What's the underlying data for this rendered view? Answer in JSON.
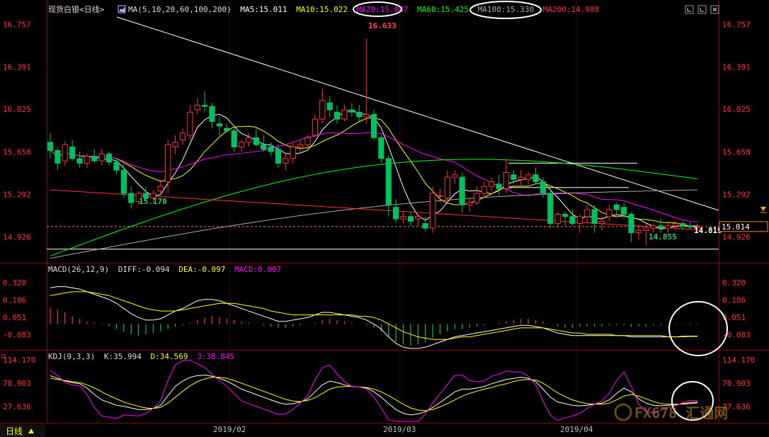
{
  "window": {
    "instrument": "现货白银<日线>",
    "period_button": "日线"
  },
  "colors": {
    "bg": "#000000",
    "up": "#ff3333",
    "down": "#00c060",
    "axis_label": "#ff3333",
    "ma5": "#ffffff",
    "ma10": "#ffff00",
    "ma20": "#ff00ff",
    "ma60": "#00ff00",
    "ma100": "#aaaaaa",
    "ma200": "#ff3333",
    "diff": "#ffffff",
    "dea": "#ffff00",
    "j_line": "#ff00ff",
    "trendline": "#ffffff"
  },
  "icons": [
    "toggle-panel-icon",
    "image-icon",
    "page-icon",
    "close-icon",
    "down-arrow-icon"
  ],
  "main_panel": {
    "header": {
      "ma_group": "MA(5,10,20,60,100,200)",
      "ma5": "MA5:15.011",
      "ma10": "MA10:15.022",
      "ma20": "MA20:15.087",
      "ma60": "MA60:15.425",
      "ma100": "MA100:15.330",
      "ma200": "MA200:14.988"
    },
    "y_ticks": [
      "16.757",
      "16.391",
      "16.025",
      "15.658",
      "15.292",
      "14.926"
    ],
    "annotations": {
      "high_label": "16.633",
      "low_label_left": "15.170",
      "low_label_right": "14.855",
      "support_label": "14.819",
      "current_price": "15.014"
    }
  },
  "macd_panel": {
    "header": {
      "name": "MACD(26,12,9)",
      "diff": "DIFF:-0.094",
      "dea": "DEA:-0.097",
      "macd": "MACD:0.007"
    },
    "y_ticks": [
      "0.320",
      "0.186",
      "0.051",
      "-0.083"
    ]
  },
  "kdj_panel": {
    "header": {
      "name": "KDJ(9,3,3)",
      "k": "K:35.994",
      "d": "D:34.569",
      "j": "J:38.845"
    },
    "y_ticks": [
      "114.170",
      "70.903",
      "27.636"
    ]
  },
  "x_axis": {
    "labels": [
      "2019/02",
      "2019/03",
      "2019/04"
    ]
  },
  "watermark": {
    "text": "FX678 汇通网"
  },
  "chart_data": {
    "type": "candlestick",
    "main": {
      "ylim": [
        14.72,
        16.82
      ],
      "candles": [
        [
          15.74,
          15.82,
          15.6,
          15.67
        ],
        [
          15.67,
          15.7,
          15.5,
          15.56
        ],
        [
          15.58,
          15.75,
          15.54,
          15.72
        ],
        [
          15.7,
          15.76,
          15.58,
          15.6
        ],
        [
          15.6,
          15.66,
          15.52,
          15.56
        ],
        [
          15.56,
          15.64,
          15.52,
          15.62
        ],
        [
          15.62,
          15.68,
          15.56,
          15.58
        ],
        [
          15.58,
          15.68,
          15.54,
          15.64
        ],
        [
          15.64,
          15.66,
          15.54,
          15.57
        ],
        [
          15.57,
          15.6,
          15.46,
          15.5
        ],
        [
          15.5,
          15.55,
          15.26,
          15.3
        ],
        [
          15.3,
          15.36,
          15.17,
          15.22
        ],
        [
          15.23,
          15.32,
          15.2,
          15.3
        ],
        [
          15.3,
          15.36,
          15.24,
          15.26
        ],
        [
          15.26,
          15.33,
          15.22,
          15.3
        ],
        [
          15.32,
          15.42,
          15.28,
          15.36
        ],
        [
          15.4,
          15.76,
          15.3,
          15.72
        ],
        [
          15.7,
          15.8,
          15.64,
          15.74
        ],
        [
          15.76,
          15.86,
          15.72,
          15.82
        ],
        [
          15.8,
          16.06,
          15.76,
          16.0
        ],
        [
          16.02,
          16.12,
          15.98,
          16.06
        ],
        [
          16.06,
          16.18,
          16.0,
          16.05
        ],
        [
          16.05,
          16.08,
          15.86,
          15.92
        ],
        [
          15.9,
          15.96,
          15.8,
          15.88
        ],
        [
          15.86,
          15.9,
          15.82,
          15.84
        ],
        [
          15.84,
          15.88,
          15.66,
          15.7
        ],
        [
          15.7,
          15.76,
          15.66,
          15.74
        ],
        [
          15.74,
          15.82,
          15.7,
          15.78
        ],
        [
          15.78,
          15.86,
          15.7,
          15.72
        ],
        [
          15.72,
          15.8,
          15.66,
          15.68
        ],
        [
          15.7,
          15.74,
          15.62,
          15.66
        ],
        [
          15.68,
          15.72,
          15.52,
          15.56
        ],
        [
          15.56,
          15.64,
          15.5,
          15.6
        ],
        [
          15.6,
          15.74,
          15.56,
          15.7
        ],
        [
          15.7,
          15.76,
          15.66,
          15.72
        ],
        [
          15.72,
          15.8,
          15.7,
          15.78
        ],
        [
          15.8,
          15.98,
          15.78,
          15.94
        ],
        [
          15.94,
          16.2,
          15.9,
          16.1
        ],
        [
          16.08,
          16.14,
          15.96,
          16.02
        ],
        [
          16.0,
          16.06,
          15.9,
          15.94
        ],
        [
          15.94,
          16.06,
          15.92,
          16.02
        ],
        [
          16.02,
          16.08,
          15.96,
          16.0
        ],
        [
          16.0,
          16.06,
          15.92,
          15.96
        ],
        [
          15.96,
          16.633,
          15.9,
          15.98
        ],
        [
          15.98,
          16.02,
          15.76,
          15.78
        ],
        [
          15.78,
          15.8,
          15.56,
          15.6
        ],
        [
          15.6,
          15.63,
          15.1,
          15.2
        ],
        [
          15.18,
          15.25,
          15.05,
          15.08
        ],
        [
          15.08,
          15.14,
          15.04,
          15.1
        ],
        [
          15.1,
          15.14,
          15.02,
          15.06
        ],
        [
          15.08,
          15.12,
          15.02,
          15.1
        ],
        [
          15.04,
          15.1,
          14.97,
          15.0
        ],
        [
          15.0,
          15.36,
          14.96,
          15.3
        ],
        [
          15.28,
          15.34,
          15.22,
          15.28
        ],
        [
          15.26,
          15.5,
          15.22,
          15.44
        ],
        [
          15.44,
          15.5,
          15.38,
          15.46
        ],
        [
          15.44,
          15.48,
          15.14,
          15.2
        ],
        [
          15.2,
          15.26,
          15.14,
          15.22
        ],
        [
          15.22,
          15.36,
          15.2,
          15.3
        ],
        [
          15.3,
          15.4,
          15.26,
          15.36
        ],
        [
          15.36,
          15.44,
          15.32,
          15.4
        ],
        [
          15.38,
          15.46,
          15.28,
          15.34
        ],
        [
          15.34,
          15.6,
          15.3,
          15.48
        ],
        [
          15.46,
          15.5,
          15.38,
          15.42
        ],
        [
          15.42,
          15.5,
          15.36,
          15.44
        ],
        [
          15.42,
          15.48,
          15.38,
          15.46
        ],
        [
          15.46,
          15.52,
          15.38,
          15.4
        ],
        [
          15.4,
          15.44,
          15.26,
          15.3
        ],
        [
          15.3,
          15.34,
          15.0,
          15.04
        ],
        [
          15.04,
          15.14,
          15.0,
          15.12
        ],
        [
          15.12,
          15.14,
          15.02,
          15.1
        ],
        [
          15.1,
          15.16,
          15.02,
          15.04
        ],
        [
          15.04,
          15.12,
          14.96,
          15.1
        ],
        [
          15.1,
          15.2,
          15.04,
          15.16
        ],
        [
          15.16,
          15.2,
          14.96,
          15.04
        ],
        [
          15.04,
          15.1,
          14.98,
          15.06
        ],
        [
          15.1,
          15.2,
          15.06,
          15.16
        ],
        [
          15.2,
          15.22,
          15.12,
          15.16
        ],
        [
          15.18,
          15.22,
          15.08,
          15.12
        ],
        [
          15.12,
          15.14,
          14.88,
          14.96
        ],
        [
          14.96,
          15.02,
          14.9,
          14.98
        ],
        [
          14.98,
          15.04,
          14.855,
          15.0
        ],
        [
          15.0,
          15.04,
          14.96,
          15.02
        ],
        [
          15.02,
          15.08,
          14.96,
          15.0
        ],
        [
          15.0,
          15.06,
          14.96,
          15.02
        ],
        [
          15.02,
          15.06,
          14.98,
          15.04
        ],
        [
          15.04,
          15.06,
          14.98,
          15.02
        ],
        [
          15.02,
          15.05,
          14.99,
          15.01
        ],
        [
          15.01,
          15.04,
          14.98,
          15.014
        ]
      ],
      "levels": {
        "support": 14.819,
        "last": 15.014
      }
    },
    "macd": {
      "ylim": [
        -0.19,
        0.37
      ],
      "histogram": [
        0.13,
        0.11,
        0.09,
        0.06,
        0.04,
        0.02,
        0.01,
        -0.005,
        -0.02,
        -0.04,
        -0.06,
        -0.08,
        -0.09,
        -0.08,
        -0.07,
        -0.06,
        -0.04,
        -0.02,
        -0.01,
        0.01,
        0.03,
        0.05,
        0.06,
        0.05,
        0.04,
        0.03,
        0.02,
        0.01,
        0.0,
        -0.01,
        -0.02,
        -0.03,
        -0.03,
        -0.02,
        -0.01,
        0.0,
        0.01,
        0.03,
        0.04,
        0.03,
        0.02,
        0.01,
        0.0,
        -0.01,
        -0.03,
        -0.06,
        -0.1,
        -0.14,
        -0.16,
        -0.17,
        -0.16,
        -0.14,
        -0.11,
        -0.08,
        -0.06,
        -0.04,
        -0.04,
        -0.03,
        -0.02,
        -0.01,
        0.0,
        0.01,
        0.02,
        0.03,
        0.04,
        0.04,
        0.03,
        0.02,
        0.0,
        -0.02,
        -0.03,
        -0.03,
        -0.02,
        -0.02,
        -0.02,
        -0.02,
        -0.01,
        -0.01,
        -0.01,
        -0.02,
        -0.02,
        -0.02,
        -0.01,
        -0.01,
        0.0,
        0.005,
        0.005,
        0.007,
        0.007
      ],
      "diff": [
        0.28,
        0.29,
        0.29,
        0.28,
        0.27,
        0.25,
        0.23,
        0.21,
        0.19,
        0.16,
        0.12,
        0.08,
        0.05,
        0.03,
        0.03,
        0.04,
        0.07,
        0.1,
        0.12,
        0.15,
        0.18,
        0.19,
        0.19,
        0.18,
        0.16,
        0.14,
        0.12,
        0.1,
        0.08,
        0.06,
        0.04,
        0.02,
        0.02,
        0.03,
        0.04,
        0.05,
        0.07,
        0.09,
        0.09,
        0.08,
        0.07,
        0.06,
        0.05,
        0.03,
        0.0,
        -0.04,
        -0.1,
        -0.15,
        -0.18,
        -0.19,
        -0.19,
        -0.18,
        -0.16,
        -0.14,
        -0.12,
        -0.1,
        -0.09,
        -0.08,
        -0.07,
        -0.06,
        -0.05,
        -0.04,
        -0.03,
        -0.02,
        -0.01,
        -0.01,
        -0.02,
        -0.03,
        -0.05,
        -0.07,
        -0.08,
        -0.09,
        -0.09,
        -0.09,
        -0.09,
        -0.09,
        -0.09,
        -0.09,
        -0.09,
        -0.1,
        -0.1,
        -0.1,
        -0.1,
        -0.1,
        -0.1,
        -0.1,
        -0.095,
        -0.094,
        -0.094
      ],
      "dea": [
        0.22,
        0.23,
        0.24,
        0.25,
        0.25,
        0.25,
        0.24,
        0.23,
        0.22,
        0.2,
        0.18,
        0.16,
        0.14,
        0.12,
        0.11,
        0.1,
        0.1,
        0.1,
        0.11,
        0.12,
        0.13,
        0.14,
        0.15,
        0.16,
        0.16,
        0.16,
        0.15,
        0.14,
        0.13,
        0.12,
        0.1,
        0.09,
        0.08,
        0.07,
        0.07,
        0.07,
        0.07,
        0.07,
        0.07,
        0.07,
        0.07,
        0.07,
        0.06,
        0.06,
        0.05,
        0.03,
        0.0,
        -0.03,
        -0.06,
        -0.08,
        -0.1,
        -0.11,
        -0.12,
        -0.12,
        -0.12,
        -0.11,
        -0.1,
        -0.1,
        -0.09,
        -0.08,
        -0.07,
        -0.06,
        -0.05,
        -0.04,
        -0.03,
        -0.03,
        -0.03,
        -0.03,
        -0.04,
        -0.05,
        -0.06,
        -0.07,
        -0.07,
        -0.08,
        -0.08,
        -0.08,
        -0.08,
        -0.09,
        -0.09,
        -0.09,
        -0.09,
        -0.09,
        -0.09,
        -0.09,
        -0.1,
        -0.1,
        -0.1,
        -0.097,
        -0.097
      ]
    },
    "kdj": {
      "ylim": [
        0,
        125
      ],
      "k": [
        85,
        80,
        75,
        72,
        70,
        62,
        50,
        40,
        35,
        30,
        28,
        25,
        22,
        22,
        24,
        30,
        48,
        65,
        75,
        82,
        85,
        86,
        84,
        80,
        75,
        68,
        60,
        55,
        50,
        45,
        40,
        35,
        32,
        33,
        36,
        42,
        55,
        68,
        75,
        72,
        68,
        65,
        64,
        62,
        55,
        45,
        33,
        22,
        15,
        12,
        14,
        18,
        26,
        35,
        45,
        55,
        60,
        60,
        62,
        65,
        70,
        74,
        78,
        80,
        82,
        80,
        74,
        60,
        45,
        36,
        33,
        30,
        29,
        30,
        32,
        34,
        40,
        52,
        62,
        55,
        42,
        34,
        30,
        29,
        30,
        31,
        33,
        35,
        35.994
      ],
      "d": [
        80,
        78,
        76,
        74,
        72,
        68,
        62,
        55,
        48,
        42,
        36,
        32,
        28,
        25,
        24,
        26,
        34,
        45,
        56,
        66,
        74,
        79,
        82,
        82,
        80,
        76,
        71,
        66,
        61,
        56,
        51,
        46,
        41,
        38,
        37,
        39,
        44,
        52,
        60,
        64,
        65,
        65,
        64,
        63,
        60,
        55,
        48,
        40,
        32,
        25,
        21,
        20,
        22,
        27,
        33,
        40,
        47,
        52,
        56,
        60,
        63,
        67,
        70,
        74,
        77,
        78,
        77,
        71,
        62,
        53,
        46,
        40,
        36,
        33,
        32,
        32,
        34,
        40,
        47,
        50,
        47,
        42,
        37,
        33,
        32,
        32,
        32,
        33,
        34.569
      ],
      "j": [
        95,
        85,
        72,
        68,
        66,
        50,
        26,
        10,
        8,
        5,
        12,
        11,
        10,
        15,
        24,
        38,
        76,
        105,
        113,
        114,
        107,
        100,
        88,
        76,
        65,
        52,
        38,
        33,
        28,
        23,
        18,
        13,
        14,
        22,
        34,
        48,
        77,
        100,
        105,
        88,
        74,
        65,
        64,
        60,
        45,
        25,
        3,
        -14,
        -19,
        -14,
        0,
        14,
        34,
        51,
        69,
        85,
        86,
        76,
        74,
        75,
        84,
        88,
        94,
        92,
        92,
        84,
        68,
        38,
        11,
        2,
        7,
        10,
        15,
        24,
        32,
        38,
        52,
        76,
        92,
        65,
        32,
        18,
        16,
        21,
        26,
        29,
        35,
        39,
        38.845
      ]
    }
  }
}
